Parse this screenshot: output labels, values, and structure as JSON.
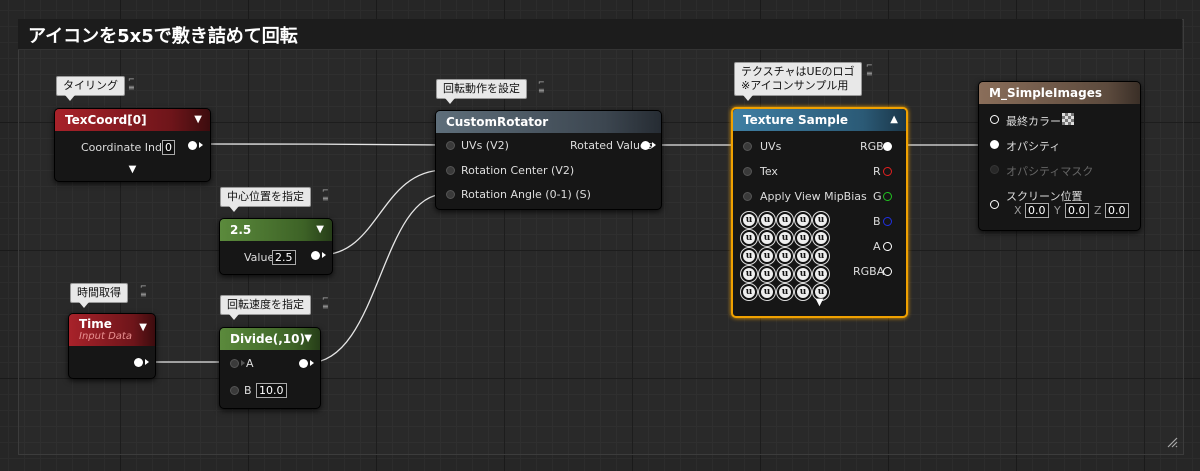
{
  "comment": {
    "title": "アイコンを5x5で敷き詰めて回転"
  },
  "bubbles": {
    "texcoord": "タイリング",
    "constant": "中心位置を指定",
    "time": "時間取得",
    "divide": "回転速度を指定",
    "rotator": "回転動作を設定",
    "texture_line1": "テクスチャはUEのロゴ",
    "texture_line2": "※アイコンサンプル用"
  },
  "texcoord": {
    "title": "TexCoord[0]",
    "field_label": "Coordinate Index",
    "field_value": "0"
  },
  "constant": {
    "title": "2.5",
    "field_label": "Value",
    "field_value": "2.5"
  },
  "time": {
    "title": "Time",
    "subtitle": "Input Data"
  },
  "divide": {
    "title": "Divide(,10)",
    "pin_a": "A",
    "pin_b": "B",
    "b_value": "10.0"
  },
  "rotator": {
    "title": "CustomRotator",
    "inputs": [
      "UVs (V2)",
      "Rotation Center (V2)",
      "Rotation Angle (0-1) (S)"
    ],
    "output": "Rotated Values"
  },
  "texture": {
    "title": "Texture Sample",
    "inputs": [
      "UVs",
      "Tex",
      "Apply View MipBias"
    ],
    "outputs": [
      "RGB",
      "R",
      "G",
      "B",
      "A",
      "RGBA"
    ],
    "icon_glyph": "u",
    "icon_count": 25
  },
  "material": {
    "title": "M_SimpleImages",
    "base_color": "最終カラー",
    "opacity": "オパシティ",
    "opacity_mask": "オパシティマスク",
    "screen_position": "スクリーン位置",
    "x_label": "X",
    "x_value": "0.0",
    "y_label": "Y",
    "y_value": "0.0",
    "z_label": "Z",
    "z_value": "0.0"
  },
  "colors": {
    "selection": "#f0a100",
    "pin_r": "#e02020",
    "pin_g": "#20c020",
    "pin_b": "#2030e0"
  },
  "icons": {
    "collapse": "chevron-down-icon",
    "expand": "chevron-down-icon",
    "pin_toggle": "pin-icon",
    "resize": "resize-grip-icon",
    "base_color_swatch": "checker-swatch-icon"
  }
}
